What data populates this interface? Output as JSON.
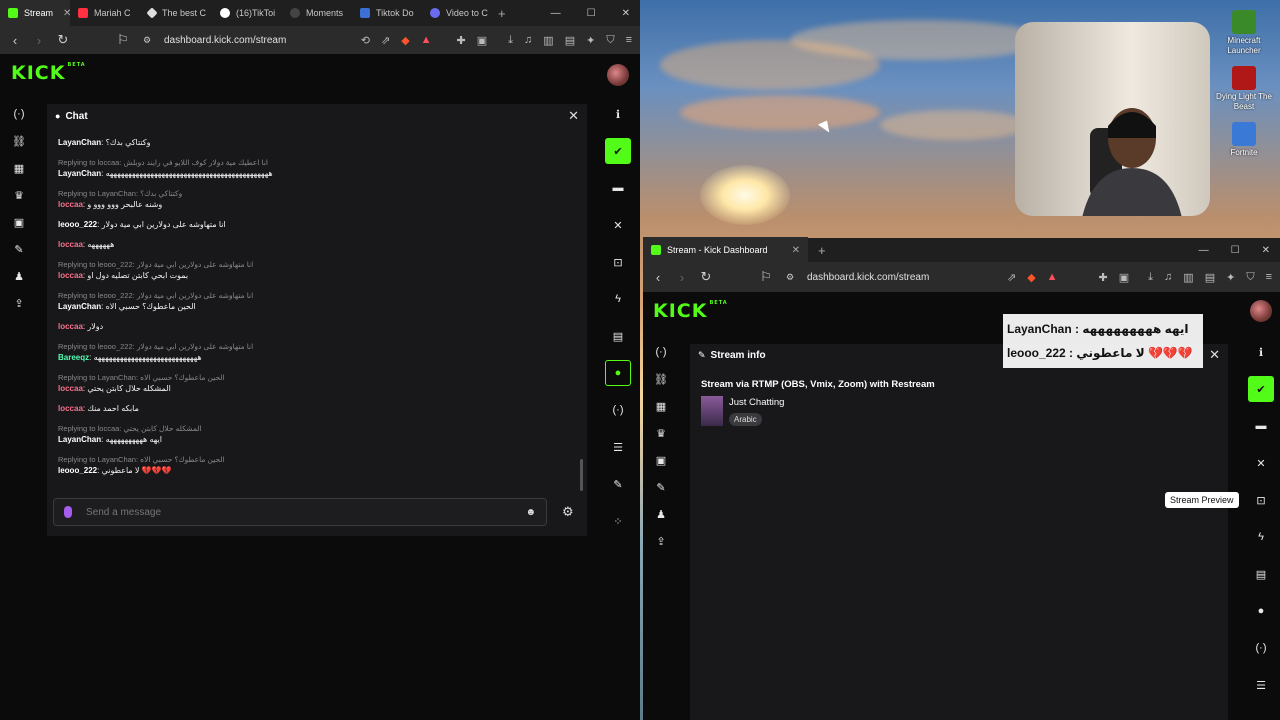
{
  "left_browser": {
    "tabs": [
      {
        "label": "Stream",
        "color": "#53fc18"
      },
      {
        "label": "Mariah C",
        "color": "#ff3040"
      },
      {
        "label": "The best C",
        "color": "#dddddd"
      },
      {
        "label": "(16)TikToi",
        "color": "#ffffff"
      },
      {
        "label": "Moments",
        "color": "#444444"
      },
      {
        "label": "Tiktok Do",
        "color": "#3b6fd6"
      },
      {
        "label": "Video to C",
        "color": "#6a6cf0"
      }
    ],
    "url": "dashboard.kick.com/stream",
    "logo": "KICK",
    "beta": "BETA",
    "chat": {
      "title": "Chat",
      "messages": [
        {
          "reply": "",
          "user": "LayanChan",
          "text": ": وكتتاكي بدك؟"
        },
        {
          "reply": "Replying to loccaa: انا اعطيك مية دولار كوف اللايو في رايند دوبلش",
          "user": "LayanChan",
          "text": ": ههههههههههههههههههههههههههههههههههههههههههههه"
        },
        {
          "reply": "Replying to LayanChan: وكتتاكي بدك؟",
          "user": "loccaa",
          "text": ": وشنه عالبحر ووو ووو و"
        },
        {
          "reply": "",
          "user": "leooo_222",
          "text": ": انا متهاوشه على دولارين ابي مية دولار"
        },
        {
          "reply": "",
          "user": "loccaa",
          "text": ": ههههههه"
        },
        {
          "reply": "Replying to leooo_222: انا متهاوشه على دولارين ابي مية دولار",
          "user": "loccaa",
          "text": ": بموت ابحي كابتن تصليه دول او"
        },
        {
          "reply": "Replying to leooo_222: انا متهاوشه على دولارين ابي مية دولار",
          "user": "LayanChan",
          "text": ": الحين ماعطوك؟ حسبي الاه"
        },
        {
          "reply": "",
          "user": "loccaa",
          "text": ": دولار"
        },
        {
          "reply": "Replying to leooo_222: انا متهاوشه على دولارين ابي مية دولار",
          "user": "Bareeqz",
          "text": ": ههههههههههههههههههههههههههههه"
        },
        {
          "reply": "Replying to LayanChan: الحين ماعطوك؟ حسبي الاه",
          "user": "loccaa",
          "text": ": المشكله حلال كابتن يحتي"
        },
        {
          "reply": "",
          "user": "loccaa",
          "text": ": مابكه احمد منك"
        },
        {
          "reply": "Replying to loccaa: المشكله حلال كابتن يحتي",
          "user": "LayanChan",
          "text": ": ايهه ههههههههههه"
        },
        {
          "reply": "Replying to LayanChan: الحين ماعطوك؟ حسبي الاه",
          "user": "leooo_222",
          "text": ": لا ماعطوني 💔💔💔"
        }
      ],
      "input_placeholder": "Send a message"
    }
  },
  "right_browser": {
    "tab_title": "Stream - Kick Dashboard",
    "url": "dashboard.kick.com/stream",
    "logo": "KICK",
    "beta": "BETA",
    "stream_info": {
      "title": "Stream info",
      "stream_title": "Stream via RTMP (OBS, Vmix, Zoom) with Restream",
      "category": "Just Chatting",
      "language_tag": "Arabic"
    },
    "tooltip": "Stream Preview"
  },
  "overlay_chat": [
    {
      "user": "LayanChan",
      "text": "ايهه هههههههههه"
    },
    {
      "user": "leooo_222",
      "text": "لا ماعطوني 💔💔💔"
    }
  ],
  "desktop_icons": [
    {
      "label": "Minecraft Launcher",
      "color": "#3a8a2a"
    },
    {
      "label": "Dying Light The Beast",
      "color": "#b01818"
    },
    {
      "label": "Fortnite",
      "color": "#3a7ad6"
    }
  ],
  "colors": {
    "accent": "#53fc18",
    "panel": "#18181b"
  }
}
